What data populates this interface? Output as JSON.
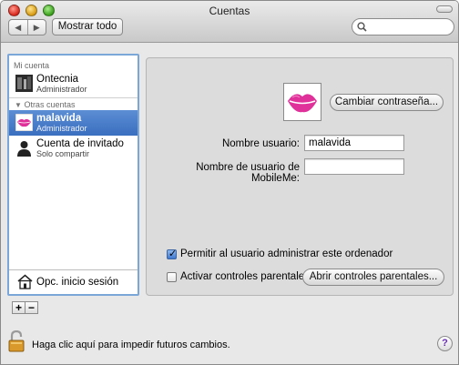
{
  "window": {
    "title": "Cuentas"
  },
  "toolbar": {
    "back_label": "◀",
    "forward_label": "▶",
    "show_all_label": "Mostrar todo",
    "search_placeholder": ""
  },
  "sidebar": {
    "my_account_header": "Mi cuenta",
    "my_account": {
      "name": "Ontecnia",
      "role": "Administrador"
    },
    "other_accounts_header": "Otras cuentas",
    "other_accounts": [
      {
        "name": "malavida",
        "role": "Administrador",
        "selected": true
      },
      {
        "name": "Cuenta de invitado",
        "role": "Solo compartir",
        "selected": false
      }
    ],
    "login_options_label": "Opc. inicio sesión",
    "add_label": "+",
    "remove_label": "−"
  },
  "details": {
    "change_password_label": "Cambiar contraseña...",
    "username_label": "Nombre usuario:",
    "username_value": "malavida",
    "mobileme_label": "Nombre de usuario de MobileMe:",
    "mobileme_value": "",
    "allow_admin_label": "Permitir al usuario administrar este ordenador",
    "allow_admin_checked": true,
    "parental_label": "Activar controles parentales",
    "parental_checked": false,
    "open_parental_label": "Abrir controles parentales..."
  },
  "footer": {
    "lock_text": "Haga clic aquí para impedir futuros cambios.",
    "help_label": "?"
  },
  "colors": {
    "selection": "#3a6ebf",
    "focus_ring": "#7ba6d8",
    "panel": "#dcdcdc"
  }
}
